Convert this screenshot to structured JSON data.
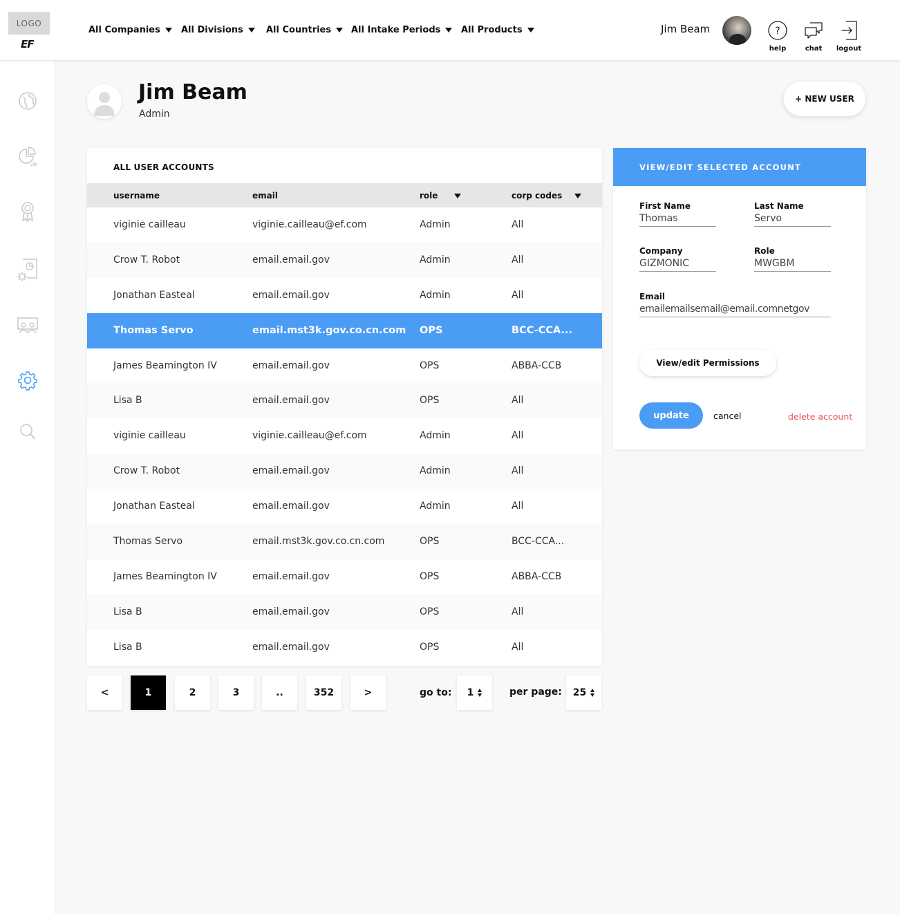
{
  "header": {
    "logo_text": "LOGO",
    "brand_mark": "EF",
    "filters": [
      {
        "label": "All Companies"
      },
      {
        "label": "All Divisions"
      },
      {
        "label": "All Countries"
      },
      {
        "label": "All Intake Periods"
      },
      {
        "label": "All Products"
      }
    ],
    "user_name": "Jim Beam",
    "actions": {
      "help": "help",
      "chat": "chat",
      "logout": "logout"
    }
  },
  "sidebar": {
    "items": [
      {
        "icon": "globe-icon"
      },
      {
        "icon": "pie-chart-icon"
      },
      {
        "icon": "award-ribbon-icon"
      },
      {
        "icon": "report-settings-icon"
      },
      {
        "icon": "classroom-icon"
      },
      {
        "icon": "gear-icon",
        "active": true
      },
      {
        "icon": "search-icon"
      }
    ],
    "colors": {
      "inactive": "#c8c8c8",
      "active": "#4a9cf5"
    }
  },
  "profile": {
    "name": "Jim Beam",
    "role": "Admin"
  },
  "new_user_label": "+ NEW USER",
  "accounts_table": {
    "title": "ALL USER ACCOUNTS",
    "columns": {
      "username": "username",
      "email": "email",
      "role": "role",
      "corp_codes": "corp codes"
    },
    "rows": [
      {
        "username": "viginie cailleau",
        "email": "viginie.cailleau@ef.com",
        "role": "Admin",
        "corp": "All"
      },
      {
        "username": "Crow T. Robot",
        "email": "email.email.gov",
        "role": "Admin",
        "corp": "All"
      },
      {
        "username": "Jonathan Easteal",
        "email": "email.email.gov",
        "role": "Admin",
        "corp": "All"
      },
      {
        "username": "Thomas Servo",
        "email": "email.mst3k.gov.co.cn.com",
        "role": "OPS",
        "corp": "BCC-CCA...",
        "selected": true
      },
      {
        "username": "James Beamington IV",
        "email": "email.email.gov",
        "role": "OPS",
        "corp": "ABBA-CCB"
      },
      {
        "username": "Lisa B",
        "email": "email.email.gov",
        "role": "OPS",
        "corp": "All"
      },
      {
        "username": "viginie cailleau",
        "email": "viginie.cailleau@ef.com",
        "role": "Admin",
        "corp": "All"
      },
      {
        "username": "Crow T. Robot",
        "email": "email.email.gov",
        "role": "Admin",
        "corp": "All"
      },
      {
        "username": "Jonathan Easteal",
        "email": "email.email.gov",
        "role": "Admin",
        "corp": "All"
      },
      {
        "username": "Thomas Servo",
        "email": "email.mst3k.gov.co.cn.com",
        "role": "OPS",
        "corp": "BCC-CCA..."
      },
      {
        "username": "James Beamington IV",
        "email": "email.email.gov",
        "role": "OPS",
        "corp": "ABBA-CCB"
      },
      {
        "username": "Lisa B",
        "email": "email.email.gov",
        "role": "OPS",
        "corp": "All"
      },
      {
        "username": "Lisa B",
        "email": "email.email.gov",
        "role": "OPS",
        "corp": "All"
      }
    ]
  },
  "pagination": {
    "prev": "<",
    "pages": [
      "1",
      "2",
      "3",
      "..",
      "352"
    ],
    "current": "1",
    "next": ">",
    "goto_label": "go to:",
    "goto_value": "1",
    "per_page_label": "per page:",
    "per_page_value": "25"
  },
  "edit_panel": {
    "title": "VIEW/EDIT SELECTED ACCOUNT",
    "fields": {
      "first_name": {
        "label": "First Name",
        "value": "Thomas"
      },
      "last_name": {
        "label": "Last Name",
        "value": "Servo"
      },
      "company": {
        "label": "Company",
        "value": "GIZMONIC"
      },
      "role": {
        "label": "Role",
        "value": "MWGBM"
      },
      "email": {
        "label": "Email",
        "value": "emailemailsemail@email.comnetgov"
      }
    },
    "permissions_label": "View/edit Permissions",
    "update_label": "update",
    "cancel_label": "cancel",
    "delete_label": "delete account"
  },
  "colors": {
    "accent": "#4a9cf5",
    "danger": "#e8515a",
    "header_row": "#e6e6e6"
  }
}
